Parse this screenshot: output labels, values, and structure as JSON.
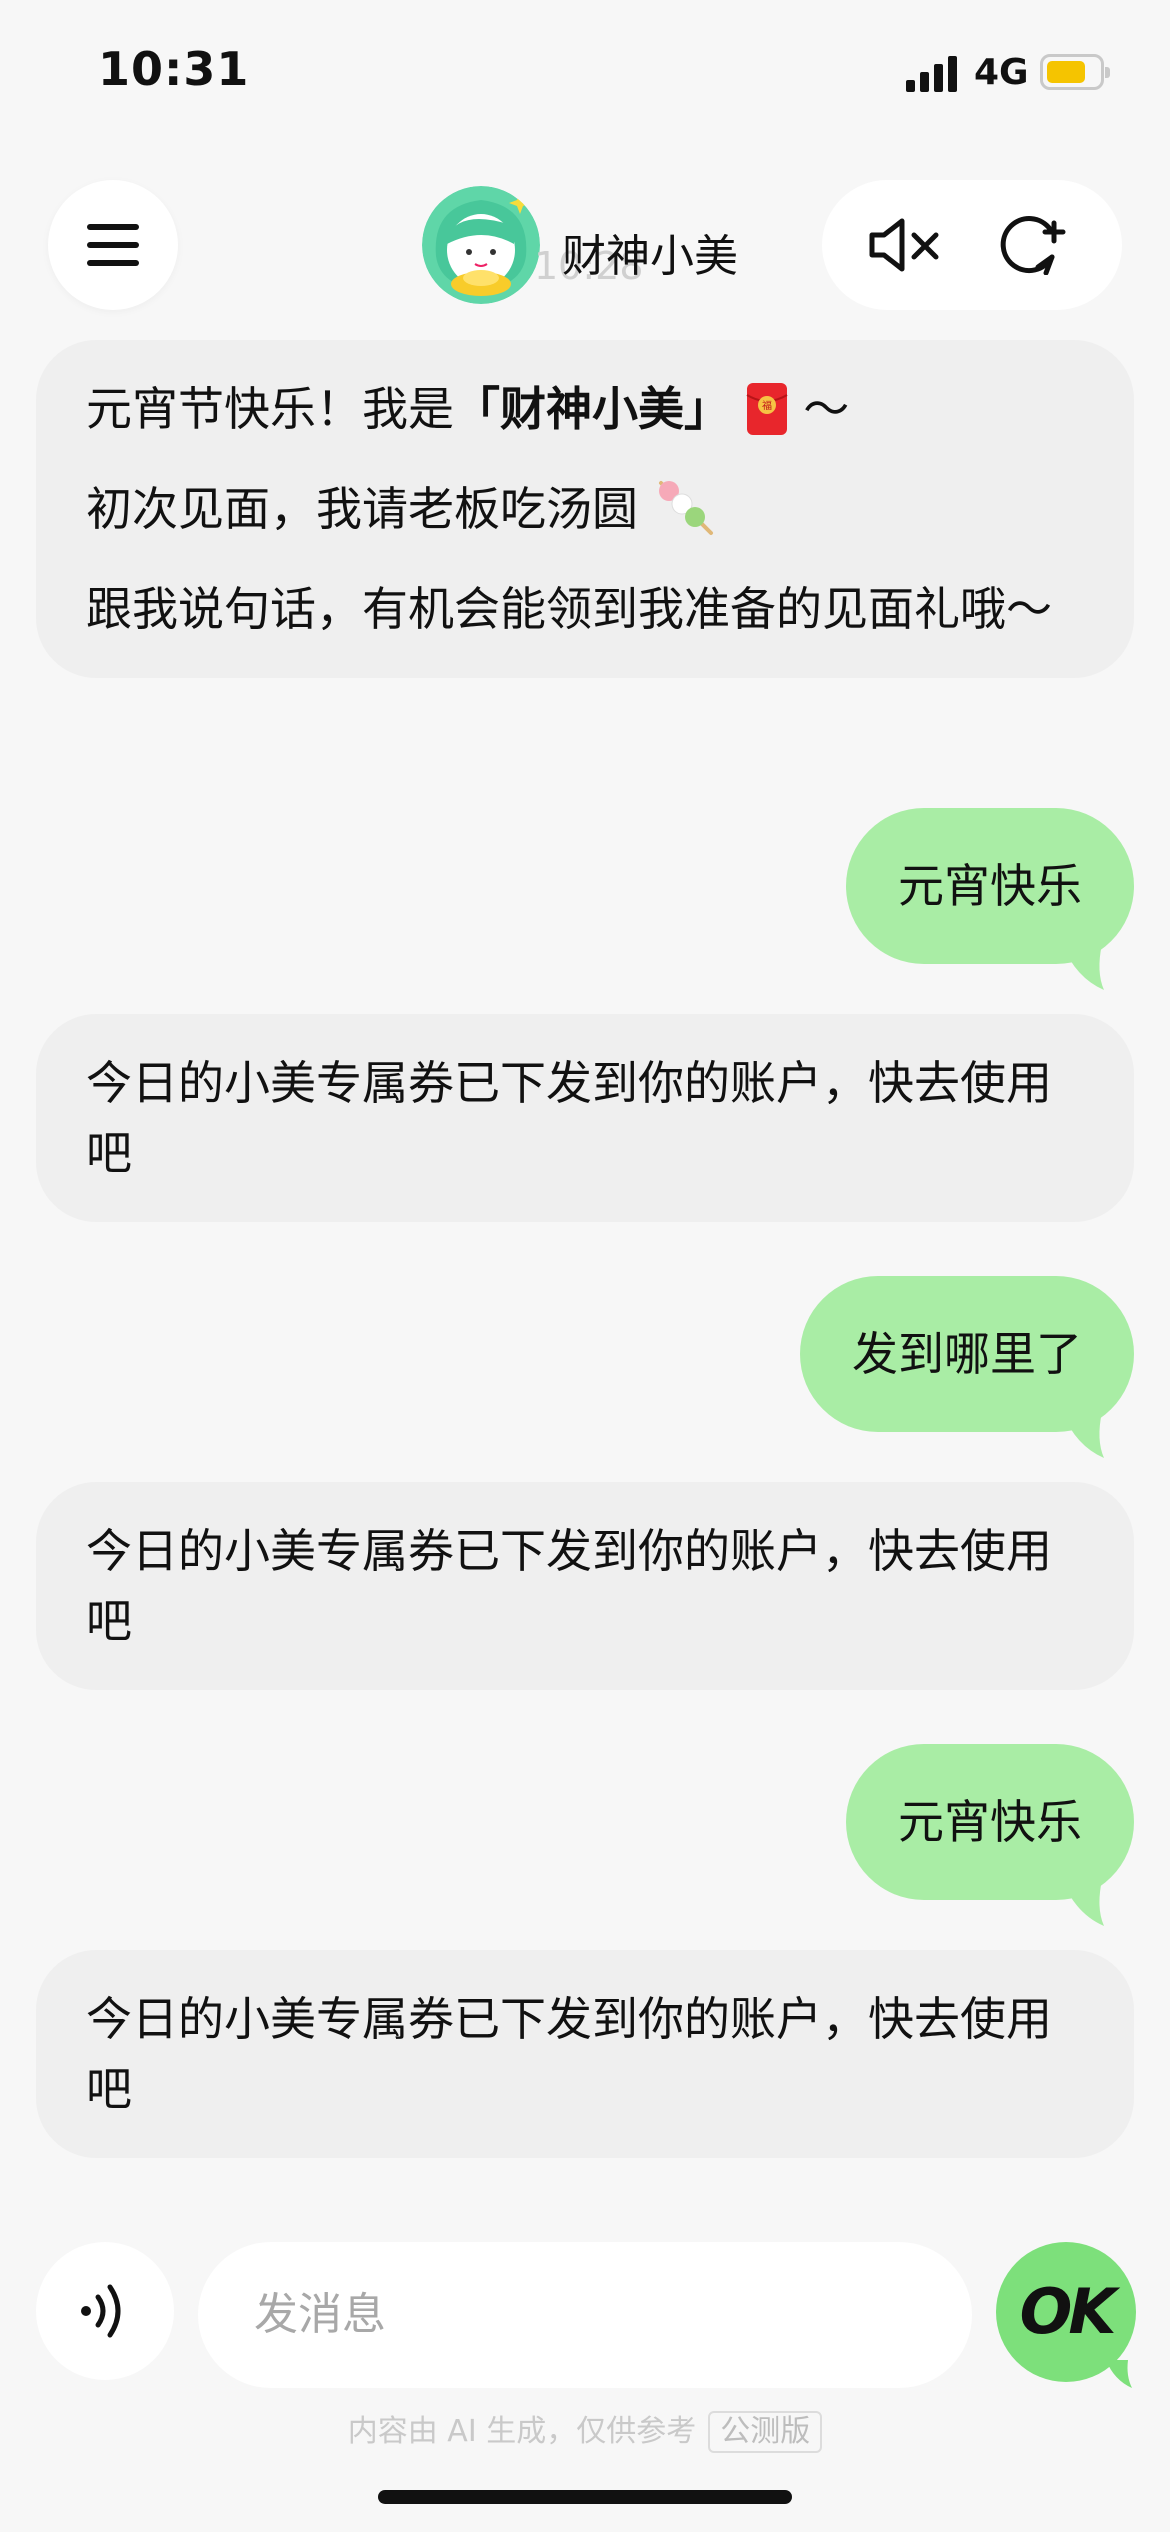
{
  "status_bar": {
    "time": "10:31",
    "network": "4G"
  },
  "header": {
    "bot_name": "财神小美",
    "ghost_time": "10:28",
    "menu_icon": "menu-icon",
    "mute_icon": "speaker-muted-icon",
    "new_chat_icon": "new-chat-icon"
  },
  "messages": [
    {
      "role": "bot",
      "lines": [
        {
          "pre": "元宵节快乐！我是",
          "bold": "「财神小美」",
          "post": "～",
          "emoji": "red-envelope"
        },
        {
          "text": "初次见面，我请老板吃汤圆",
          "emoji": "tangyuan"
        },
        {
          "text": "跟我说句话，有机会能领到我准备的见面礼哦～"
        }
      ]
    },
    {
      "role": "user",
      "text": "元宵快乐"
    },
    {
      "role": "bot",
      "text": "今日的小美专属券已下发到你的账户，快去使用吧"
    },
    {
      "role": "user",
      "text": "发到哪里了"
    },
    {
      "role": "bot",
      "text": "今日的小美专属券已下发到你的账户，快去使用吧"
    },
    {
      "role": "user",
      "text": "元宵快乐"
    },
    {
      "role": "bot",
      "text": "今日的小美专属券已下发到你的账户，快去使用吧"
    }
  ],
  "composer": {
    "placeholder": "发消息",
    "voice_icon": "voice-input-icon",
    "send_label": "OK"
  },
  "footer": {
    "disclaimer": "内容由 AI 生成，仅供参考",
    "beta_tag": "公测版"
  },
  "colors": {
    "user_bubble": "#a9eda5",
    "bot_bubble": "#efefef",
    "ok_button": "#7de07b",
    "background": "#f7f7f7"
  }
}
